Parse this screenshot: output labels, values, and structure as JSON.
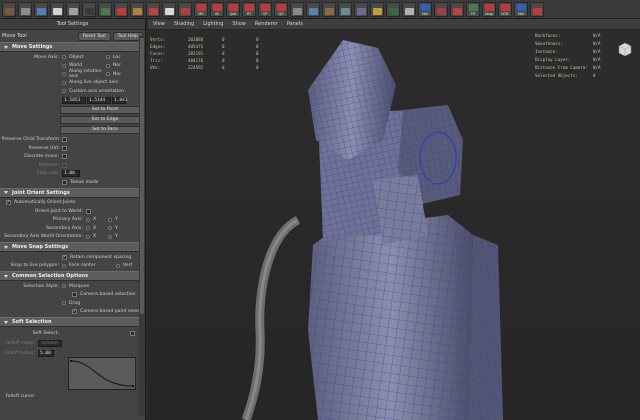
{
  "shelf": {
    "buttons": [
      {
        "icon": "move-tool-icon",
        "label": "",
        "color": "#7a5a3c"
      },
      {
        "icon": "grid-icon",
        "label": "",
        "color": "#8c8c8c"
      },
      {
        "icon": "cube-icon",
        "label": "",
        "color": "#4e7fb8"
      },
      {
        "icon": "wireframe-icon",
        "label": "",
        "color": "#d2d2d2"
      },
      {
        "icon": "shade-icon",
        "label": "",
        "color": "#a0a0a0"
      },
      {
        "icon": "texture-icon",
        "label": "",
        "color": "#3a3a3a"
      },
      {
        "icon": "render-icon",
        "label": "",
        "color": "#4a7a4a"
      },
      {
        "icon": "sphere-icon",
        "label": "",
        "color": "#c43a3a"
      },
      {
        "icon": "camera-icon",
        "label": "",
        "color": "#b08040"
      },
      {
        "icon": "reference-icon",
        "label": "",
        "color": "#c04040"
      },
      {
        "icon": "plane-icon",
        "label": "",
        "color": "#d8d8d8"
      },
      {
        "icon": "swirl-icon",
        "label": "",
        "color": "#b04040"
      },
      {
        "icon": "ms-script-icon",
        "label": "MS",
        "color": "#c03a3a"
      },
      {
        "icon": "all-script-icon",
        "label": "All",
        "color": "#c03a3a"
      },
      {
        "icon": "quit-script-icon",
        "label": "Quit",
        "color": "#c03a3a"
      },
      {
        "icon": "rt-script-icon",
        "label": "RT",
        "color": "#c03a3a"
      },
      {
        "icon": "cp-script-icon",
        "label": "CP",
        "color": "#c03a3a"
      },
      {
        "icon": "qs-script-icon",
        "label": "QS",
        "color": "#c03a3a"
      },
      {
        "icon": "edge-icon",
        "label": "",
        "color": "#8a8a8a"
      },
      {
        "icon": "bevel-icon",
        "label": "",
        "color": "#5a80b0"
      },
      {
        "icon": "ring-icon",
        "label": "",
        "color": "#8a6a40"
      },
      {
        "icon": "extrude-icon",
        "label": "",
        "color": "#6a8a9a"
      },
      {
        "icon": "loop-icon",
        "label": "",
        "color": "#6a6a9a"
      },
      {
        "icon": "bridge-icon",
        "label": "",
        "color": "#c0a030"
      },
      {
        "icon": "split-icon",
        "label": "",
        "color": "#3a6a3a"
      },
      {
        "icon": "merge-icon",
        "label": "",
        "color": "#b0b0b0"
      },
      {
        "icon": "hist-button-icon",
        "label": "Hist",
        "color": "#3060b0"
      },
      {
        "icon": "cut-icon",
        "label": "",
        "color": "#a04040"
      },
      {
        "icon": "uv-icon",
        "label": "",
        "color": "#c04040"
      },
      {
        "icon": "fr-script-icon",
        "label": "FR",
        "color": "#4a7a4a"
      },
      {
        "icon": "unsp-script-icon",
        "label": "Unsp",
        "color": "#c03a3a"
      },
      {
        "icon": "ute-script-icon",
        "label": "UTE",
        "color": "#c03a3a"
      },
      {
        "icon": "hist2-button-icon",
        "label": "Hist",
        "color": "#3060b0"
      },
      {
        "icon": "delete-history-icon",
        "label": "",
        "color": "#c03a3a"
      }
    ]
  },
  "tool_panel": {
    "title": "Tool Settings",
    "tool_name": "Move Tool",
    "reset_label": "Reset Tool",
    "help_label": "Tool Help",
    "move_settings": {
      "header": "Move Settings",
      "move_axis_label": "Move Axis:",
      "axis_options_left": [
        "Object",
        "World",
        "Along rotation axis",
        "Along live object axis",
        "Custom axis orientation"
      ],
      "axis_options_right": [
        "Loc",
        "Nor",
        "Nor"
      ],
      "custom_values": [
        "1.5853",
        "1.5144",
        "1.841"
      ],
      "set_to_point": "Set to Point",
      "set_to_edge": "Set to Edge",
      "set_to_face": "Set to Face",
      "preserve_child": "Preserve Child Transform",
      "preserve_uvs": "Preserve UVs",
      "discrete_move": "Discrete move:",
      "relative": "Relative:",
      "step_size": "Step size:",
      "step_value": "1.00",
      "tweak_mode": "Tweak mode"
    },
    "joint_orient": {
      "header": "Joint Orient Settings",
      "auto_orient": "Automatically Orient Joints",
      "orient_world": "Orient Joint to World:",
      "primary_axis": "Primary Axis:",
      "secondary_axis": "Secondary Axis:",
      "world_orient": "Secondary Axis World Orientation:",
      "x": "X",
      "y": "Y"
    },
    "snap": {
      "header": "Move Snap Settings",
      "retain_spacing": "Retain component spacing",
      "snap_live": "Snap to live polygon:",
      "face_center": "Face center",
      "vert_partial": "Vert"
    },
    "common": {
      "header": "Common Selection Options",
      "style_label": "Selection Style:",
      "marquee": "Marquee",
      "camera_selection": "Camera based selection",
      "drag": "Drag",
      "camera_paint": "Camera based paint select"
    },
    "soft": {
      "header": "Soft Selection",
      "soft_select": "Soft Select:",
      "falloff_mode": "Falloff mode:",
      "falloff_mode_value": "Volume",
      "falloff_radius": "Falloff radius:",
      "falloff_radius_value": "5.00",
      "falloff_curve": "Falloff curve:"
    }
  },
  "viewport": {
    "menu": [
      "View",
      "Shading",
      "Lighting",
      "Show",
      "Renderer",
      "Panels"
    ],
    "hud_left": [
      {
        "key": "Verts:",
        "value": "203888"
      },
      {
        "key": "Edges:",
        "value": "405475"
      },
      {
        "key": "Faces:",
        "value": "202191"
      },
      {
        "key": "Tris:",
        "value": "404176"
      },
      {
        "key": "UVs:",
        "value": "224592"
      }
    ],
    "hud_zeros": [
      "0",
      "0"
    ],
    "hud_right": [
      {
        "key": "Backfaces:",
        "value": "N/A"
      },
      {
        "key": "Smoothness:",
        "value": "N/A"
      },
      {
        "key": "Instance:",
        "value": "N/A"
      },
      {
        "key": "Display Layer:",
        "value": "N/A"
      },
      {
        "key": "Distance From Camera:",
        "value": "N/A"
      },
      {
        "key": "Selected Objects:",
        "value": "0"
      }
    ],
    "colors": {
      "mesh": "#878aa6",
      "wire": "#2f36c8",
      "cable": "#8c8c8c"
    }
  }
}
